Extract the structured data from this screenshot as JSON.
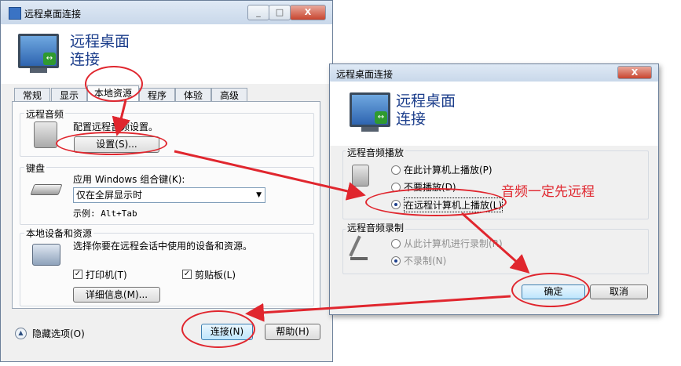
{
  "win1": {
    "title": "远程桌面连接",
    "header_line1": "远程桌面",
    "header_line2": "连接",
    "tabs": [
      "常规",
      "显示",
      "本地资源",
      "程序",
      "体验",
      "高级"
    ],
    "audio_group": "远程音频",
    "audio_text": "配置远程音频设置。",
    "audio_settings_btn": "设置(S)...",
    "keyboard_group": "键盘",
    "keyboard_text": "应用 Windows 组合键(K):",
    "keyboard_select": "仅在全屏显示时",
    "keyboard_example": "示例: Alt+Tab",
    "devices_group": "本地设备和资源",
    "devices_text": "选择你要在远程会话中使用的设备和资源。",
    "printer": "打印机(T)",
    "clipboard": "剪贴板(L)",
    "details_btn": "详细信息(M)...",
    "hide_options": "隐藏选项(O)",
    "connect_btn": "连接(N)",
    "help_btn": "帮助(H)",
    "window_buttons": [
      "_",
      "□",
      "X"
    ]
  },
  "win2": {
    "title": "远程桌面连接",
    "header_line1": "远程桌面",
    "header_line2": "连接",
    "playback_group": "远程音频播放",
    "play_local": "在此计算机上播放(P)",
    "no_play": "不要播放(D)",
    "play_remote": "在远程计算机上播放(L)",
    "record_group": "远程音频录制",
    "record_local": "从此计算机进行录制(R)",
    "no_record": "不录制(N)",
    "ok_btn": "确定",
    "cancel_btn": "取消",
    "close_btn": "X"
  },
  "annotation": "音频一定先远程",
  "colors": {
    "annotation_red": "#e0262e",
    "header_blue": "#1d3f8c"
  }
}
